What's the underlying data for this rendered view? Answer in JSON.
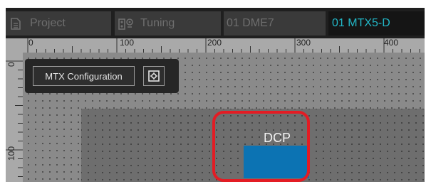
{
  "tabs": [
    {
      "label": "Project",
      "icon": "document-icon",
      "active": false
    },
    {
      "label": "Tuning",
      "icon": "tuning-icon",
      "active": false
    },
    {
      "label": "01 DME7",
      "active": false
    },
    {
      "label": "01 MTX5-D",
      "active": true
    }
  ],
  "ruler": {
    "horizontal": [
      "0",
      "100",
      "200",
      "300",
      "400"
    ],
    "vertical": [
      "0",
      "100"
    ]
  },
  "toolbar": {
    "mtx_config_label": "MTX Configuration",
    "config_icon": "device-settings-icon"
  },
  "component": {
    "label": "DCP",
    "color": "#0c73b3",
    "highlight_color": "#e31c24"
  },
  "colors": {
    "active_tab_text": "#22b8c8"
  }
}
